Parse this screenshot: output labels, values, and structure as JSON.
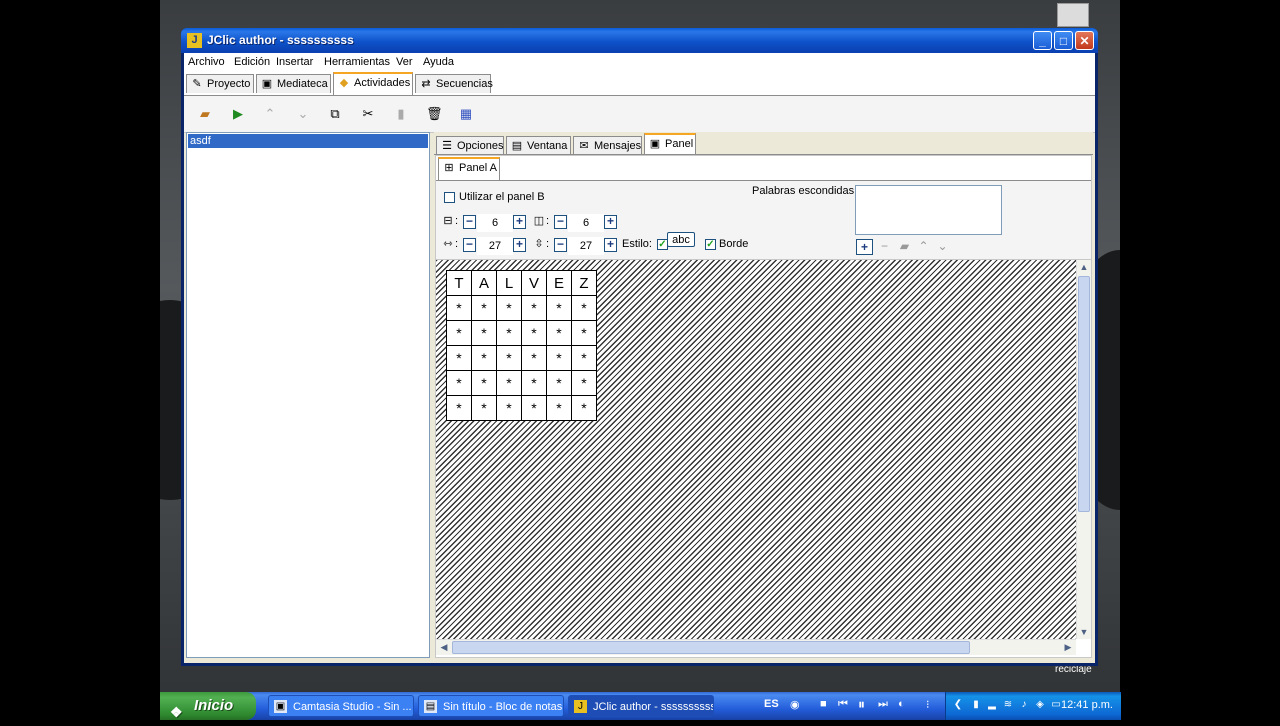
{
  "window": {
    "title": "JClic author - ssssssssss",
    "app_icon": "jclic-icon"
  },
  "menu": [
    "Archivo",
    "Edición",
    "Insertar",
    "Herramientas",
    "Ver",
    "Ayuda"
  ],
  "main_tabs": [
    {
      "label": "Proyecto",
      "icon": "project-icon"
    },
    {
      "label": "Mediateca",
      "icon": "media-library-icon"
    },
    {
      "label": "Actividades",
      "icon": "activities-icon",
      "active": true
    },
    {
      "label": "Secuencias",
      "icon": "sequences-icon"
    }
  ],
  "activity_list": {
    "items": [
      "asdf"
    ],
    "selected": "asdf"
  },
  "sub_tabs": [
    {
      "label": "Opciones",
      "icon": "options-icon"
    },
    {
      "label": "Ventana",
      "icon": "window-icon"
    },
    {
      "label": "Mensajes",
      "icon": "messages-icon"
    },
    {
      "label": "Panel",
      "icon": "panel-icon",
      "active": true
    }
  ],
  "panel_tabs": [
    {
      "label": "Panel A",
      "active": true
    }
  ],
  "options": {
    "use_panel_b_label": "Utilizar el panel B",
    "use_panel_b": false,
    "rows": "6",
    "cols": "6",
    "cell_width": "27",
    "cell_height": "27",
    "style_label": "Estilo:",
    "style_checked": true,
    "style_sample": "abc",
    "border_label": "Borde",
    "border_checked": true,
    "hidden_words_label": "Palabras escondidas:",
    "colon": ":"
  },
  "grid": {
    "header": [
      "T",
      "A",
      "L",
      "V",
      "E",
      "Z"
    ],
    "rows": [
      [
        "*",
        "*",
        "*",
        "*",
        "*",
        "*"
      ],
      [
        "*",
        "*",
        "*",
        "*",
        "*",
        "*"
      ],
      [
        "*",
        "*",
        "*",
        "*",
        "*",
        "*"
      ],
      [
        "*",
        "*",
        "*",
        "*",
        "*",
        "*"
      ],
      [
        "*",
        "*",
        "*",
        "*",
        "*",
        "*"
      ]
    ]
  },
  "taskbar": {
    "start_label": "Inicio",
    "tasks": [
      {
        "label": "Camtasia Studio - Sin ...",
        "icon": "camtasia-icon"
      },
      {
        "label": "Sin título - Bloc de notas",
        "icon": "notepad-icon"
      },
      {
        "label": "JClic author - ssssssssss",
        "icon": "jclic-icon",
        "active": true
      }
    ],
    "language": "ES",
    "clock": "12:41 p.m."
  },
  "desktop": {
    "recycle_label": "reciclaje"
  }
}
